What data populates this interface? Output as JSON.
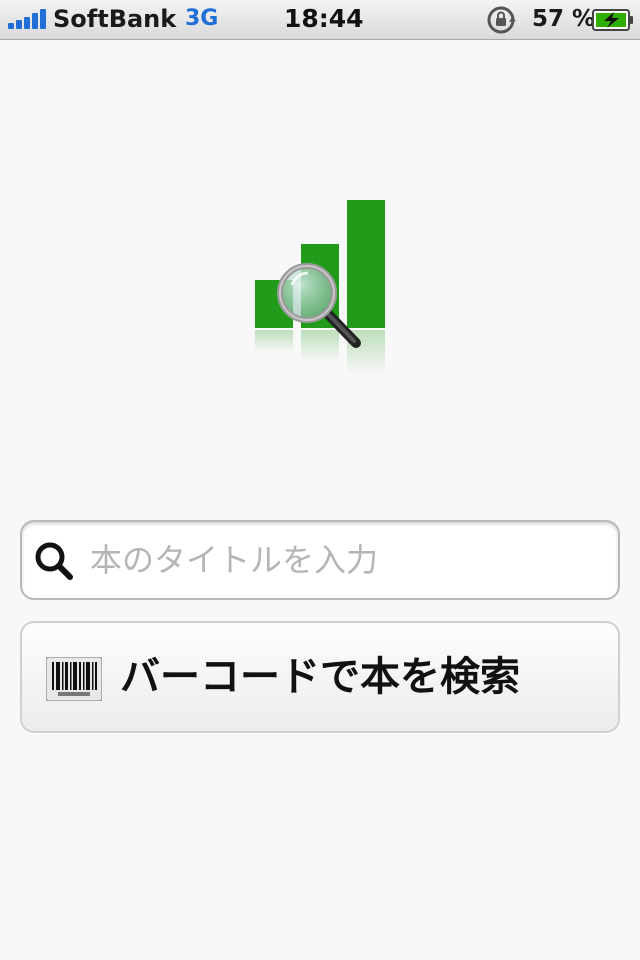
{
  "status_bar": {
    "carrier": "SoftBank",
    "network": "3G",
    "time": "18:44",
    "battery_percent": "57 %",
    "signal_bars": 5,
    "icons": [
      "signal-icon",
      "rotation-lock-icon",
      "battery-charging-icon"
    ],
    "colors": {
      "signal": "#1f6fd6",
      "network_text": "#1f6fd6",
      "battery_fill": "#2fb000"
    }
  },
  "logo": {
    "icon": "bar-chart-magnifier-icon",
    "colors": {
      "bars": "#229a1a"
    }
  },
  "search": {
    "placeholder": "本のタイトルを入力",
    "value": "",
    "icon": "search-icon"
  },
  "barcode_button": {
    "label": "バーコードで本を検索",
    "icon": "barcode-icon"
  }
}
